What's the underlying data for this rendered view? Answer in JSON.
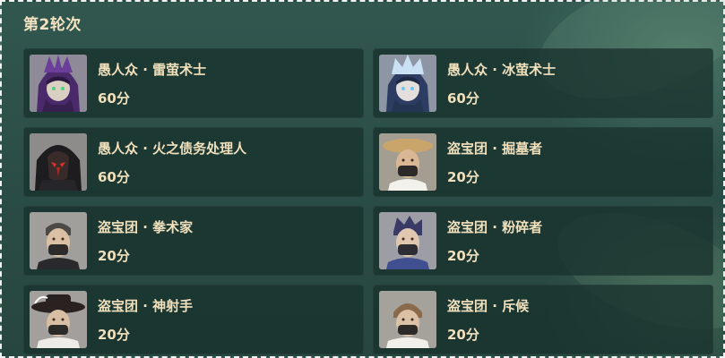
{
  "round": {
    "title": "第2轮次"
  },
  "enemies": [
    {
      "name": "愚人众 · 雷萤术士",
      "score": "60分",
      "portrait": "electro-cicin-mage"
    },
    {
      "name": "愚人众 · 冰萤术士",
      "score": "60分",
      "portrait": "cryo-cicin-mage"
    },
    {
      "name": "愚人众 · 火之债务处理人",
      "score": "60分",
      "portrait": "pyro-agent"
    },
    {
      "name": "盗宝团 · 掘墓者",
      "score": "20分",
      "portrait": "treasure-hoarder-gravedigger"
    },
    {
      "name": "盗宝团 · 拳术家",
      "score": "20分",
      "portrait": "treasure-hoarder-pugilist"
    },
    {
      "name": "盗宝团 · 粉碎者",
      "score": "20分",
      "portrait": "treasure-hoarder-crusher"
    },
    {
      "name": "盗宝团 · 神射手",
      "score": "20分",
      "portrait": "treasure-hoarder-marksman"
    },
    {
      "name": "盗宝团 · 斥候",
      "score": "20分",
      "portrait": "treasure-hoarder-scout"
    }
  ],
  "colors": {
    "text": "#f1e0bc",
    "card": "#18322d",
    "background": "#2c4f48"
  }
}
